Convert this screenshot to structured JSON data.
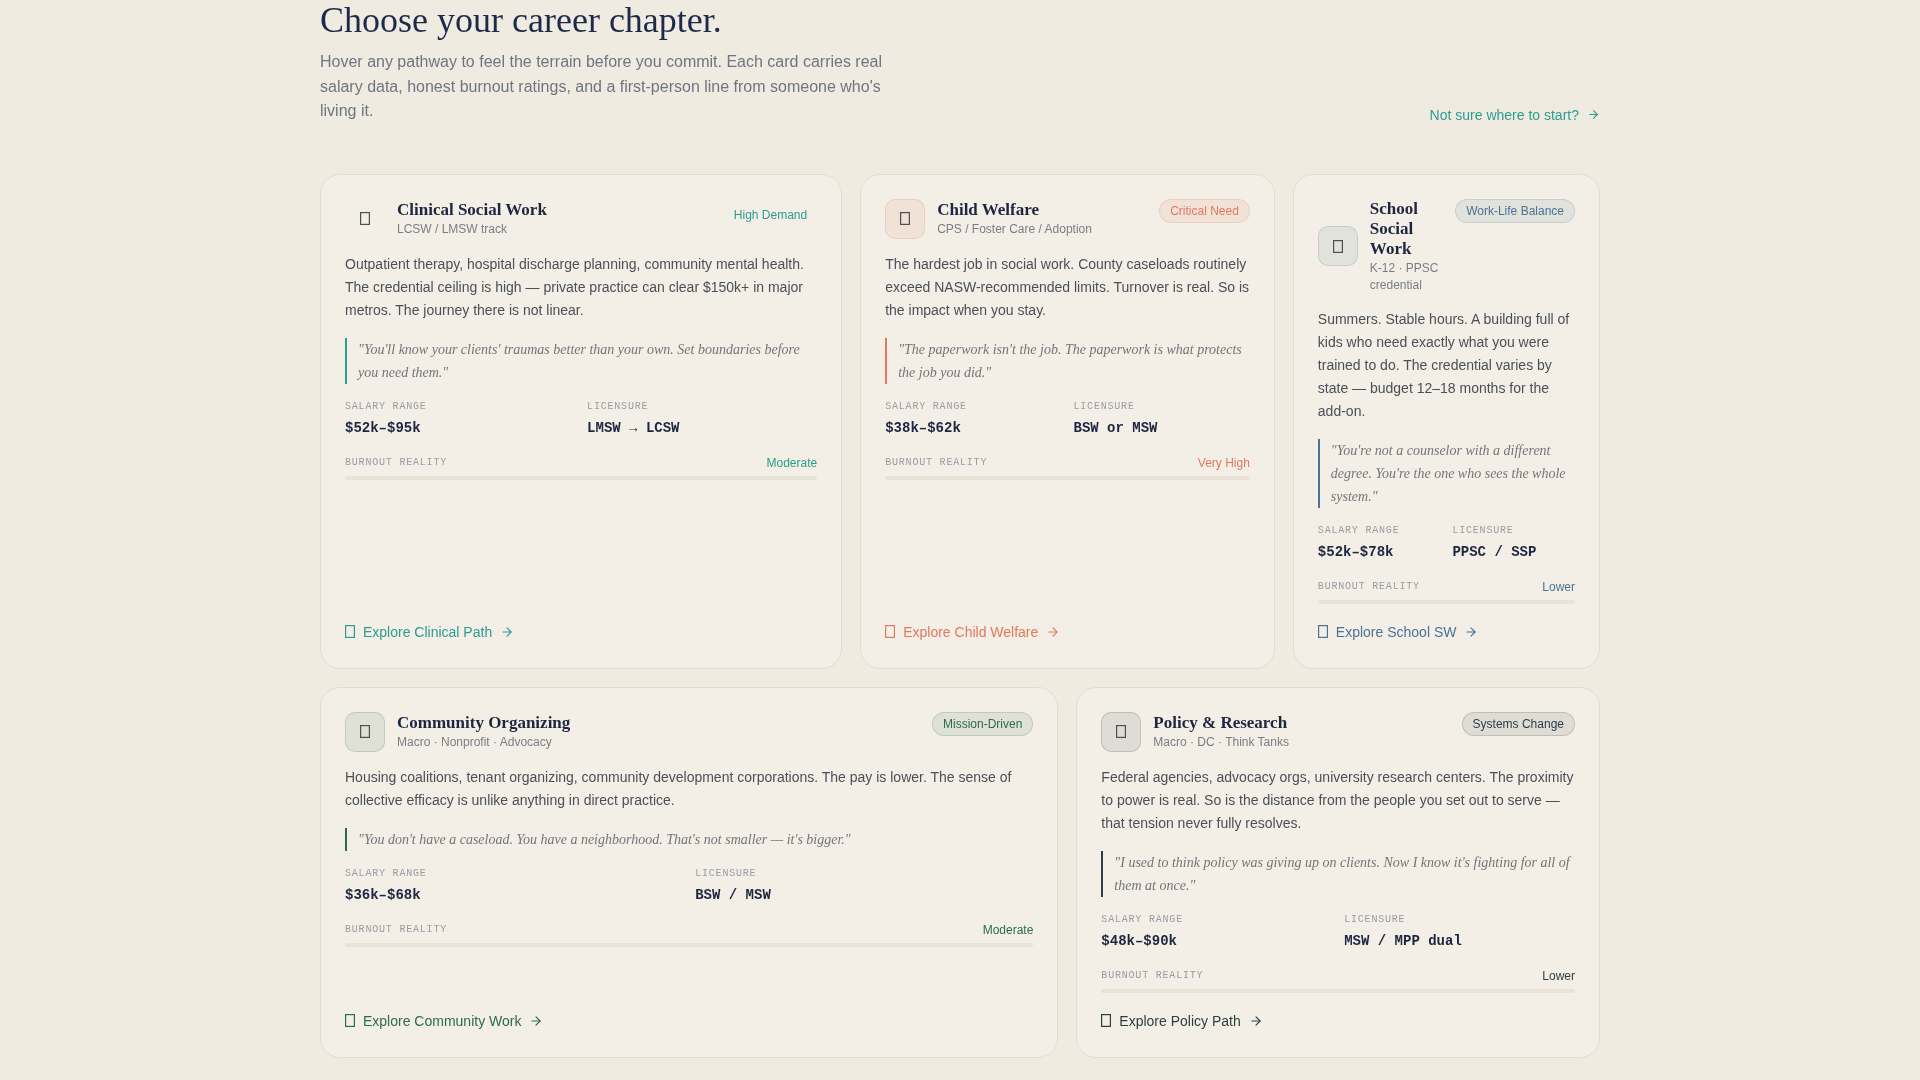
{
  "heading": "Choose your career chapter.",
  "intro": "Hover any pathway to feel the terrain before you commit. Each card carries real salary data, honest burnout ratings, and a first-person line from someone who's living it.",
  "help_link": "Not sure where to start?",
  "rows": [
    {
      "cards": [
        {
          "kind": "plain",
          "color": "#2a9d8f",
          "title": "Clinical Social Work",
          "subtitle": "LCSW / LMSW track",
          "badge": "High Demand",
          "description": "Outpatient therapy, hospital discharge planning, community mental health. The credential ceiling is high — private practice can clear $150k+ in major metros. The journey there is not linear.",
          "quote": "\"You'll know your clients' traumas better than your own. Set boundaries before you need them.\"",
          "stats": [
            {
              "label": "SALARY RANGE",
              "value": "$52k–$95k"
            },
            {
              "label": "LICENSURE",
              "value": "LMSW → LCSW"
            }
          ],
          "burnout": {
            "label": "BURNOUT REALITY",
            "reading": "Moderate"
          },
          "link": "Explore Clinical Path"
        },
        {
          "kind": "tinted",
          "color": "#e07a5f",
          "title": "Child Welfare",
          "subtitle": "CPS / Foster Care / Adoption",
          "badge": "Critical Need",
          "description": "The hardest job in social work. County caseloads routinely exceed NASW-recommended limits. Turnover is real. So is the impact when you stay.",
          "quote": "\"The paperwork isn't the job. The paperwork is what protects the job you did.\"",
          "stats": [
            {
              "label": "SALARY RANGE",
              "value": "$38k–$62k"
            },
            {
              "label": "LICENSURE",
              "value": "BSW or MSW"
            }
          ],
          "burnout": {
            "label": "BURNOUT REALITY",
            "reading": "Very High"
          },
          "link": "Explore Child Welfare"
        },
        {
          "kind": "tinted",
          "color": "#4a7396",
          "title": "School Social Work",
          "subtitle": "K-12 · PPSC credential",
          "badge": "Work-Life Balance",
          "description": "Summers. Stable hours. A building full of kids who need exactly what you were trained to do. The credential varies by state — budget 12–18 months for the add-on.",
          "quote": "\"You're not a counselor with a different degree. You're the one who sees the whole system.\"",
          "stats": [
            {
              "label": "SALARY RANGE",
              "value": "$52k–$78k"
            },
            {
              "label": "LICENSURE",
              "value": "PPSC / SSP"
            }
          ],
          "burnout": {
            "label": "BURNOUT REALITY",
            "reading": "Lower"
          },
          "link": "Explore School SW"
        }
      ]
    },
    {
      "cards": [
        {
          "kind": "tinted",
          "color": "#2d6a4f",
          "title": "Community Organizing",
          "subtitle": "Macro · Nonprofit · Advocacy",
          "badge": "Mission-Driven",
          "description": "Housing coalitions, tenant organizing, community development corporations. The pay is lower. The sense of collective efficacy is unlike anything in direct practice.",
          "quote": "\"You don't have a caseload. You have a neighborhood. That's not smaller — it's bigger.\"",
          "stats": [
            {
              "label": "SALARY RANGE",
              "value": "$36k–$68k"
            },
            {
              "label": "LICENSURE",
              "value": "BSW / MSW"
            }
          ],
          "burnout": {
            "label": "BURNOUT REALITY",
            "reading": "Moderate"
          },
          "link": "Explore Community Work"
        },
        {
          "kind": "tinted",
          "color": "#2b3f44",
          "title": "Policy & Research",
          "subtitle": "Macro · DC · Think Tanks",
          "badge": "Systems Change",
          "description": "Federal agencies, advocacy orgs, university research centers. The proximity to power is real. So is the distance from the people you set out to serve — that tension never fully resolves.",
          "quote": "\"I used to think policy was giving up on clients. Now I know it's fighting for all of them at once.\"",
          "stats": [
            {
              "label": "SALARY RANGE",
              "value": "$48k–$90k"
            },
            {
              "label": "LICENSURE",
              "value": "MSW / MPP dual"
            }
          ],
          "burnout": {
            "label": "BURNOUT REALITY",
            "reading": "Lower"
          },
          "link": "Explore Policy Path"
        }
      ]
    }
  ]
}
